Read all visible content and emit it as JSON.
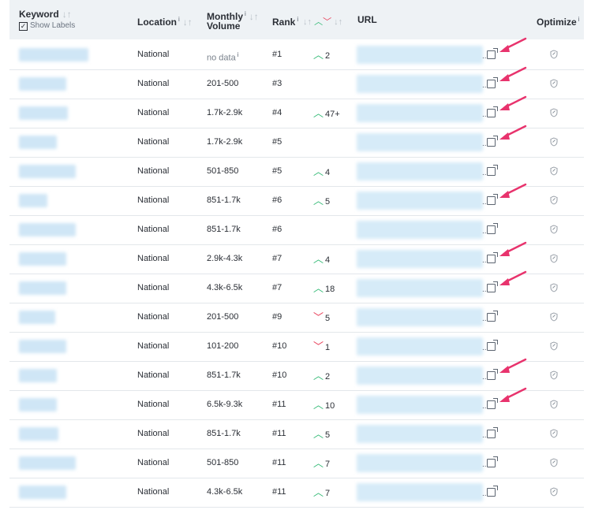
{
  "header": {
    "keyword": "Keyword",
    "show_labels": "Show Labels",
    "location": "Location",
    "monthly": "Monthly",
    "volume": "Volume",
    "rank": "Rank",
    "url": "URL",
    "optimize": "Optimize",
    "info_glyph": "i",
    "sort_glyph": "↓↑",
    "checkbox_glyph": "✓"
  },
  "colors": {
    "up": "#2eb872",
    "down": "#e8405a",
    "annotation_arrow": "#e8336d",
    "blur": "#cfe6f6"
  },
  "rows": [
    {
      "location": "National",
      "volume": "no data",
      "volume_info": "i",
      "rank": "#1",
      "dir": "up",
      "change": "2",
      "annotated": true,
      "kw_w": 88
    },
    {
      "location": "National",
      "volume": "201-500",
      "rank": "#3",
      "dir": "",
      "change": "",
      "annotated": true,
      "kw_w": 60
    },
    {
      "location": "National",
      "volume": "1.7k-2.9k",
      "rank": "#4",
      "dir": "up",
      "change": "47+",
      "annotated": true,
      "kw_w": 62
    },
    {
      "location": "National",
      "volume": "1.7k-2.9k",
      "rank": "#5",
      "dir": "",
      "change": "",
      "annotated": true,
      "kw_w": 48
    },
    {
      "location": "National",
      "volume": "501-850",
      "rank": "#5",
      "dir": "up",
      "change": "4",
      "annotated": false,
      "kw_w": 72
    },
    {
      "location": "National",
      "volume": "851-1.7k",
      "rank": "#6",
      "dir": "up",
      "change": "5",
      "annotated": true,
      "kw_w": 36
    },
    {
      "location": "National",
      "volume": "851-1.7k",
      "rank": "#6",
      "dir": "",
      "change": "",
      "annotated": false,
      "kw_w": 72
    },
    {
      "location": "National",
      "volume": "2.9k-4.3k",
      "rank": "#7",
      "dir": "up",
      "change": "4",
      "annotated": true,
      "kw_w": 60
    },
    {
      "location": "National",
      "volume": "4.3k-6.5k",
      "rank": "#7",
      "dir": "up",
      "change": "18",
      "annotated": true,
      "kw_w": 60
    },
    {
      "location": "National",
      "volume": "201-500",
      "rank": "#9",
      "dir": "down",
      "change": "5",
      "annotated": false,
      "kw_w": 46
    },
    {
      "location": "National",
      "volume": "101-200",
      "rank": "#10",
      "dir": "down",
      "change": "1",
      "annotated": false,
      "kw_w": 60
    },
    {
      "location": "National",
      "volume": "851-1.7k",
      "rank": "#10",
      "dir": "up",
      "change": "2",
      "annotated": true,
      "kw_w": 48
    },
    {
      "location": "National",
      "volume": "6.5k-9.3k",
      "rank": "#11",
      "dir": "up",
      "change": "10",
      "annotated": true,
      "kw_w": 48
    },
    {
      "location": "National",
      "volume": "851-1.7k",
      "rank": "#11",
      "dir": "up",
      "change": "5",
      "annotated": false,
      "kw_w": 50
    },
    {
      "location": "National",
      "volume": "501-850",
      "rank": "#11",
      "dir": "up",
      "change": "7",
      "annotated": false,
      "kw_w": 72
    },
    {
      "location": "National",
      "volume": "4.3k-6.5k",
      "rank": "#11",
      "dir": "up",
      "change": "7",
      "annotated": false,
      "kw_w": 60
    }
  ]
}
